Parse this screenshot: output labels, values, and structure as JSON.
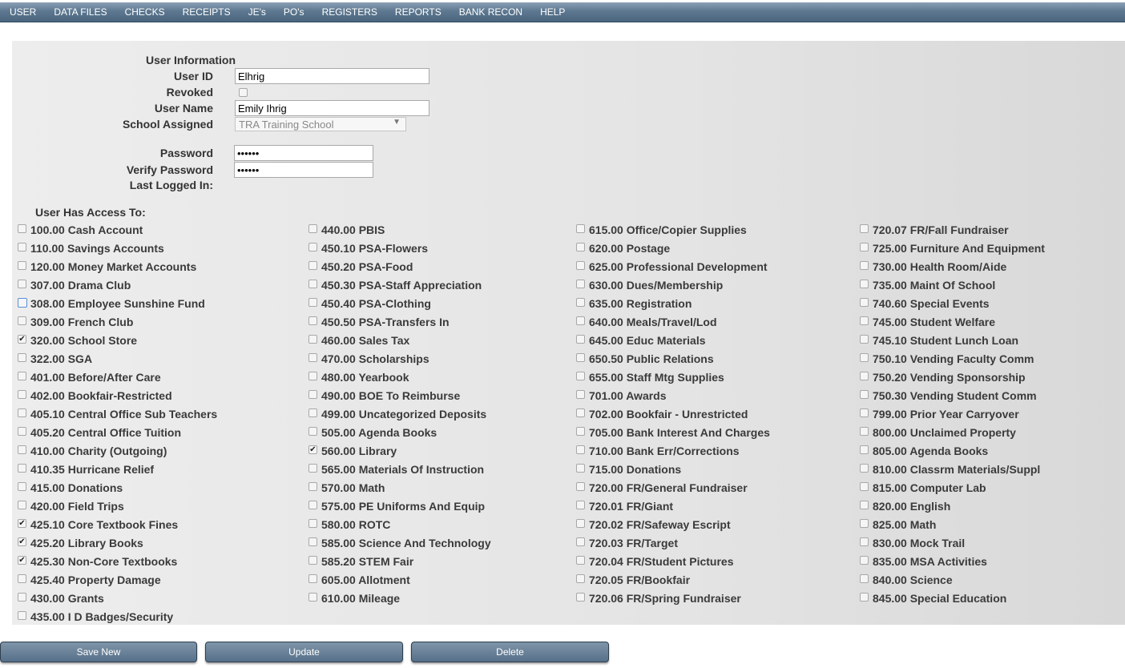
{
  "menu": [
    "USER",
    "DATA FILES",
    "CHECKS",
    "RECEIPTS",
    "JE's",
    "PO's",
    "REGISTERS",
    "REPORTS",
    "BANK RECON",
    "HELP"
  ],
  "form": {
    "section_title": "User Information",
    "user_id_label": "User ID",
    "user_id_value": "Elhrig",
    "revoked_label": "Revoked",
    "user_name_label": "User Name",
    "user_name_value": "Emily Ihrig",
    "school_label": "School Assigned",
    "school_value": "TRA Training School",
    "password_label": "Password",
    "password_value": "••••••",
    "verify_label": "Verify Password",
    "verify_value": "••••••",
    "last_logged_label": "Last Logged In:"
  },
  "access_title": "User Has Access To:",
  "accounts": [
    [
      {
        "label": "100.00 Cash Account",
        "checked": false
      },
      {
        "label": "110.00 Savings Accounts",
        "checked": false
      },
      {
        "label": "120.00 Money Market Accounts",
        "checked": false
      },
      {
        "label": "307.00 Drama Club",
        "checked": false
      },
      {
        "label": "308.00 Employee Sunshine Fund",
        "checked": false,
        "focus": true
      },
      {
        "label": "309.00 French Club",
        "checked": false
      },
      {
        "label": "320.00 School Store",
        "checked": true
      },
      {
        "label": "322.00 SGA",
        "checked": false
      },
      {
        "label": "401.00 Before/After Care",
        "checked": false
      },
      {
        "label": "402.00 Bookfair-Restricted",
        "checked": false
      },
      {
        "label": "405.10 Central Office Sub Teachers",
        "checked": false
      },
      {
        "label": "405.20 Central Office Tuition",
        "checked": false
      },
      {
        "label": "410.00 Charity (Outgoing)",
        "checked": false
      },
      {
        "label": "410.35 Hurricane Relief",
        "checked": false
      },
      {
        "label": "415.00 Donations",
        "checked": false
      },
      {
        "label": "420.00 Field Trips",
        "checked": false
      },
      {
        "label": "425.10 Core Textbook Fines",
        "checked": true
      },
      {
        "label": "425.20 Library Books",
        "checked": true
      },
      {
        "label": "425.30 Non-Core Textbooks",
        "checked": true
      },
      {
        "label": "425.40 Property Damage",
        "checked": false
      },
      {
        "label": "430.00 Grants",
        "checked": false
      },
      {
        "label": "435.00 I D Badges/Security",
        "checked": false
      }
    ],
    [
      {
        "label": "440.00 PBIS",
        "checked": false
      },
      {
        "label": "450.10 PSA-Flowers",
        "checked": false
      },
      {
        "label": "450.20 PSA-Food",
        "checked": false
      },
      {
        "label": "450.30 PSA-Staff Appreciation",
        "checked": false
      },
      {
        "label": "450.40 PSA-Clothing",
        "checked": false
      },
      {
        "label": "450.50 PSA-Transfers In",
        "checked": false
      },
      {
        "label": "460.00 Sales Tax",
        "checked": false
      },
      {
        "label": "470.00 Scholarships",
        "checked": false
      },
      {
        "label": "480.00 Yearbook",
        "checked": false
      },
      {
        "label": "490.00 BOE To Reimburse",
        "checked": false
      },
      {
        "label": "499.00 Uncategorized Deposits",
        "checked": false
      },
      {
        "label": "505.00 Agenda Books",
        "checked": false
      },
      {
        "label": "560.00 Library",
        "checked": true
      },
      {
        "label": "565.00 Materials Of Instruction",
        "checked": false
      },
      {
        "label": "570.00 Math",
        "checked": false
      },
      {
        "label": "575.00 PE Uniforms And Equip",
        "checked": false
      },
      {
        "label": "580.00 ROTC",
        "checked": false
      },
      {
        "label": "585.00 Science And Technology",
        "checked": false
      },
      {
        "label": "585.20 STEM Fair",
        "checked": false
      },
      {
        "label": "605.00 Allotment",
        "checked": false
      },
      {
        "label": "610.00 Mileage",
        "checked": false
      }
    ],
    [
      {
        "label": "615.00 Office/Copier Supplies",
        "checked": false
      },
      {
        "label": "620.00 Postage",
        "checked": false
      },
      {
        "label": "625.00 Professional Development",
        "checked": false
      },
      {
        "label": "630.00 Dues/Membership",
        "checked": false
      },
      {
        "label": "635.00 Registration",
        "checked": false
      },
      {
        "label": "640.00 Meals/Travel/Lod",
        "checked": false
      },
      {
        "label": "645.00 Educ Materials",
        "checked": false
      },
      {
        "label": "650.50 Public Relations",
        "checked": false
      },
      {
        "label": "655.00 Staff Mtg Supplies",
        "checked": false
      },
      {
        "label": "701.00 Awards",
        "checked": false
      },
      {
        "label": "702.00 Bookfair - Unrestricted",
        "checked": false
      },
      {
        "label": "705.00 Bank Interest And Charges",
        "checked": false
      },
      {
        "label": "710.00 Bank Err/Corrections",
        "checked": false
      },
      {
        "label": "715.00 Donations",
        "checked": false
      },
      {
        "label": "720.00 FR/General Fundraiser",
        "checked": false
      },
      {
        "label": "720.01 FR/Giant",
        "checked": false
      },
      {
        "label": "720.02 FR/Safeway Escript",
        "checked": false
      },
      {
        "label": "720.03 FR/Target",
        "checked": false
      },
      {
        "label": "720.04 FR/Student Pictures",
        "checked": false
      },
      {
        "label": "720.05 FR/Bookfair",
        "checked": false
      },
      {
        "label": "720.06 FR/Spring Fundraiser",
        "checked": false
      }
    ],
    [
      {
        "label": "720.07 FR/Fall Fundraiser",
        "checked": false
      },
      {
        "label": "725.00 Furniture And Equipment",
        "checked": false
      },
      {
        "label": "730.00 Health Room/Aide",
        "checked": false
      },
      {
        "label": "735.00 Maint Of School",
        "checked": false
      },
      {
        "label": "740.60 Special Events",
        "checked": false
      },
      {
        "label": "745.00 Student Welfare",
        "checked": false
      },
      {
        "label": "745.10 Student Lunch Loan",
        "checked": false
      },
      {
        "label": "750.10 Vending Faculty Comm",
        "checked": false
      },
      {
        "label": "750.20 Vending Sponsorship",
        "checked": false
      },
      {
        "label": "750.30 Vending Student Comm",
        "checked": false
      },
      {
        "label": "799.00 Prior Year Carryover",
        "checked": false
      },
      {
        "label": "800.00 Unclaimed Property",
        "checked": false
      },
      {
        "label": "805.00 Agenda Books",
        "checked": false
      },
      {
        "label": "810.00 Classrm Materials/Suppl",
        "checked": false
      },
      {
        "label": "815.00 Computer Lab",
        "checked": false
      },
      {
        "label": "820.00 English",
        "checked": false
      },
      {
        "label": "825.00 Math",
        "checked": false
      },
      {
        "label": "830.00 Mock Trail",
        "checked": false
      },
      {
        "label": "835.00 MSA Activities",
        "checked": false
      },
      {
        "label": "840.00 Science",
        "checked": false
      },
      {
        "label": "845.00 Special Education",
        "checked": false
      }
    ]
  ],
  "buttons": {
    "save_new": "Save New",
    "update": "Update",
    "delete": "Delete"
  }
}
